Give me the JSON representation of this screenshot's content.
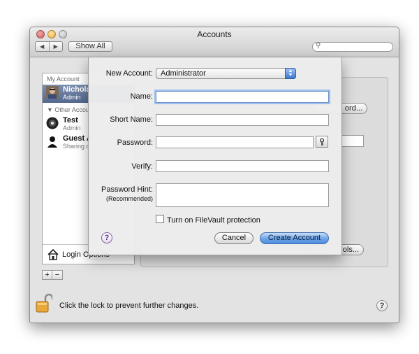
{
  "window": {
    "title": "Accounts",
    "show_all_label": "Show All",
    "nav_back_glyph": "◀",
    "nav_forward_glyph": "▶",
    "search_placeholder": ""
  },
  "sidebar": {
    "my_account_header": "My Account",
    "other_accounts_header": "▼ Other Accou",
    "items": [
      {
        "name": "Nichola",
        "role": "Admin",
        "icon": "user-photo-icon",
        "selected": true
      },
      {
        "name": "Test",
        "role": "Admin",
        "icon": "user-avatar-icon"
      },
      {
        "name": "Guest A",
        "role": "Sharing o",
        "icon": "guest-silhouette-icon"
      }
    ],
    "login_options_label": "Login Options"
  },
  "background_panel": {
    "change_password_label": "ord...",
    "parental_controls_label": "ols..."
  },
  "footer": {
    "lock_text": "Click the lock to prevent further changes.",
    "add_label": "+",
    "remove_label": "−",
    "help_label": "?"
  },
  "sheet": {
    "new_account_label": "New Account:",
    "new_account_value": "Administrator",
    "name_label": "Name:",
    "name_value": "",
    "short_name_label": "Short Name:",
    "short_name_value": "",
    "password_label": "Password:",
    "password_value": "",
    "verify_label": "Verify:",
    "verify_value": "",
    "password_hint_label": "Password Hint:",
    "password_hint_sub": "(Recommended)",
    "password_hint_value": "",
    "filevault_label": "Turn on FileVault protection",
    "filevault_checked": false,
    "help_label": "?",
    "cancel_label": "Cancel",
    "create_label": "Create Account"
  },
  "colors": {
    "selection": "#5f7397",
    "default_button": "#6ea3e6",
    "focus_ring": "#9ec0ee"
  }
}
